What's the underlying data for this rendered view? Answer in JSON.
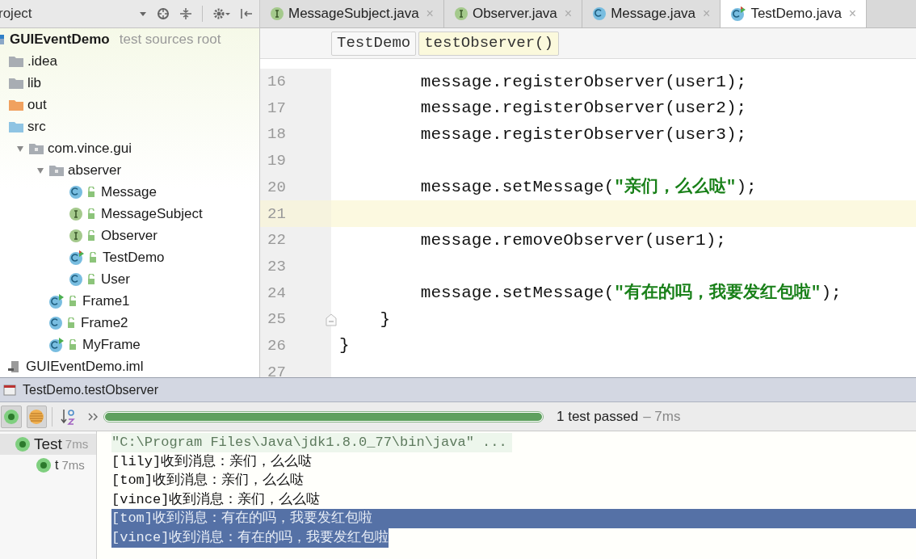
{
  "project_panel": {
    "title": "roject",
    "tree": [
      {
        "label": "GUIEventDemo",
        "kind": "module",
        "hint": "test sources root",
        "children": [
          {
            "label": ".idea",
            "kind": "folder",
            "color": "#a8adb3"
          },
          {
            "label": "lib",
            "kind": "folder",
            "color": "#a8adb3"
          },
          {
            "label": "out",
            "kind": "folder",
            "color": "#f0a15f"
          },
          {
            "label": "src",
            "kind": "folder",
            "color": "#8fc4e3",
            "children": [
              {
                "label": "com.vince.gui",
                "kind": "package",
                "expanded": true,
                "children": [
                  {
                    "label": "abserver",
                    "kind": "package",
                    "expanded": true,
                    "children": [
                      {
                        "label": "Message",
                        "kind": "class"
                      },
                      {
                        "label": "MessageSubject",
                        "kind": "interface"
                      },
                      {
                        "label": "Observer",
                        "kind": "interface"
                      },
                      {
                        "label": "TestDemo",
                        "kind": "test_class"
                      },
                      {
                        "label": "User",
                        "kind": "class"
                      }
                    ]
                  },
                  {
                    "label": "Frame1",
                    "kind": "runnable_class"
                  },
                  {
                    "label": "Frame2",
                    "kind": "class"
                  },
                  {
                    "label": "MyFrame",
                    "kind": "runnable_class"
                  }
                ]
              }
            ]
          },
          {
            "label": "GUIEventDemo.iml",
            "kind": "iml"
          }
        ]
      }
    ]
  },
  "editor": {
    "tabs": [
      {
        "label": "MessageSubject.java",
        "kind": "interface",
        "selected": false,
        "close": "×"
      },
      {
        "label": "Observer.java",
        "kind": "interface",
        "selected": false,
        "close": "×"
      },
      {
        "label": "Message.java",
        "kind": "class",
        "selected": false,
        "close": "×"
      },
      {
        "label": "TestDemo.java",
        "kind": "test_class",
        "selected": true,
        "close": "×"
      }
    ],
    "breadcrumbs": [
      {
        "label": "TestDemo",
        "selected": false
      },
      {
        "label": "testObserver()",
        "selected": true
      }
    ],
    "lines": [
      {
        "number": "16",
        "current": false,
        "parts": [
          {
            "text": "        message.registerObserver(user1);",
            "kind": "plain"
          }
        ]
      },
      {
        "number": "17",
        "current": false,
        "parts": [
          {
            "text": "        message.registerObserver(user2);",
            "kind": "plain"
          }
        ]
      },
      {
        "number": "18",
        "current": false,
        "parts": [
          {
            "text": "        message.registerObserver(user3);",
            "kind": "plain"
          }
        ]
      },
      {
        "number": "19",
        "current": false
      },
      {
        "number": "20",
        "current": false,
        "parts": [
          {
            "text": "        message.setMessage(",
            "kind": "plain"
          },
          {
            "text": "\"亲们，么么哒\"",
            "kind": "string"
          },
          {
            "text": ");",
            "kind": "plain"
          }
        ]
      },
      {
        "number": "21",
        "current": true
      },
      {
        "number": "22",
        "current": false,
        "parts": [
          {
            "text": "        message.removeObserver(user1);",
            "kind": "plain"
          }
        ]
      },
      {
        "number": "23",
        "current": false
      },
      {
        "number": "24",
        "current": false,
        "parts": [
          {
            "text": "        message.setMessage(",
            "kind": "plain"
          },
          {
            "text": "\"有在的吗，我要发红包啦\"",
            "kind": "string"
          },
          {
            "text": ");",
            "kind": "plain"
          }
        ]
      },
      {
        "number": "25",
        "current": false,
        "fold": true,
        "parts": [
          {
            "text": "    }",
            "kind": "plain"
          }
        ]
      },
      {
        "number": "26",
        "current": false,
        "parts": [
          {
            "text": "}",
            "kind": "plain"
          }
        ]
      },
      {
        "number": "27",
        "current": false
      }
    ]
  },
  "run_panel": {
    "title": "TestDemo.testObserver",
    "toolbar": [
      {
        "kind": "ok",
        "on": true
      },
      {
        "kind": "list",
        "on": true
      },
      {
        "kind": "sort",
        "on": false
      },
      {
        "kind": "more",
        "on": false
      }
    ],
    "progress": {
      "level": 1
    },
    "status": "1 test passed",
    "duration": "– 7ms",
    "tests": [
      {
        "label": "Test",
        "time": "7ms",
        "children": [
          {
            "label": "t",
            "time": "7ms"
          }
        ]
      }
    ],
    "console": [
      {
        "text": "\"C:\\Program Files\\Java\\jdk1.8.0_77\\bin\\java\" ...",
        "kind": "command",
        "selected": false
      },
      {
        "text": "[lily]收到消息：亲们，么么哒",
        "kind": "output",
        "selected": false
      },
      {
        "text": "[tom]收到消息：亲们，么么哒",
        "kind": "output",
        "selected": false
      },
      {
        "text": "[vince]收到消息：亲们，么么哒",
        "kind": "output",
        "selected": false
      },
      {
        "text": "[tom]收到消息：有在的吗，我要发红包啦",
        "kind": "output",
        "selected": true
      },
      {
        "text": "[vince]收到消息：有在的吗，我要发红包啦",
        "kind": "output",
        "selected": true
      }
    ]
  }
}
